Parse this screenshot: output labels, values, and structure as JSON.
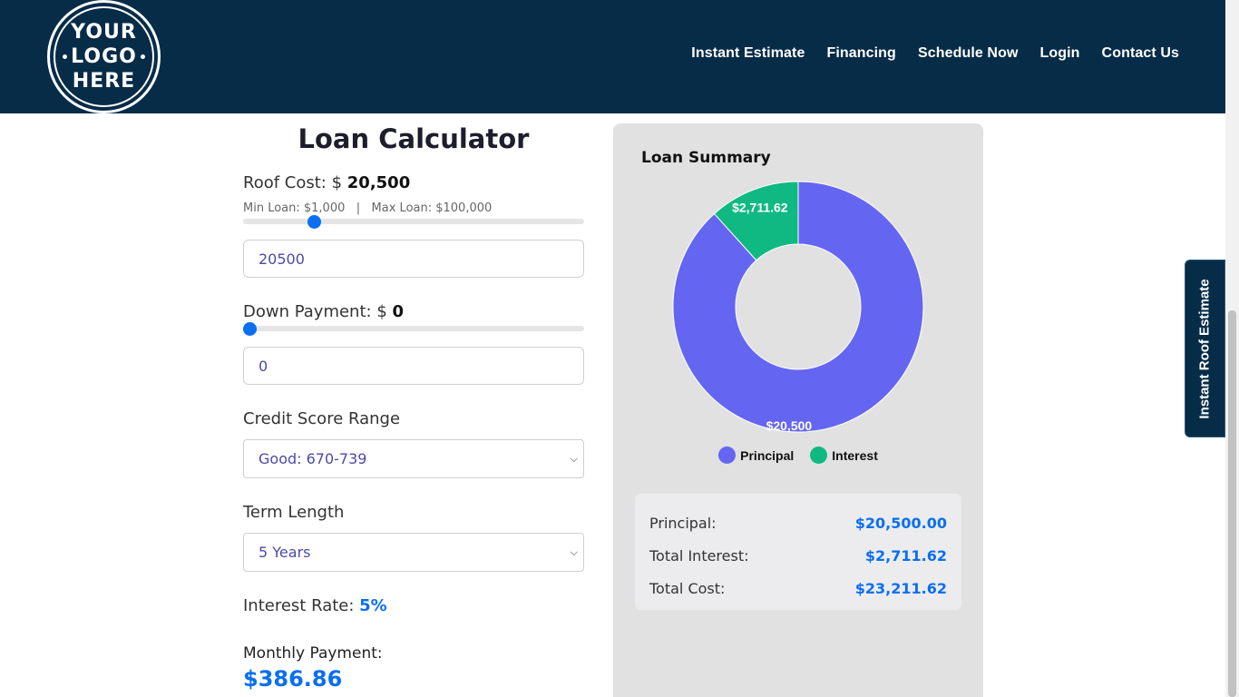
{
  "header": {
    "logo_lines": [
      "YOUR",
      "LOGO",
      "HERE"
    ],
    "nav": [
      "Instant Estimate",
      "Financing",
      "Schedule Now",
      "Login",
      "Contact Us"
    ]
  },
  "calculator": {
    "title": "Loan Calculator",
    "roof_cost": {
      "label": "Roof Cost: $ ",
      "value": "20,500",
      "input_value": "20500",
      "slider_level": 0.197
    },
    "min_max": "Min Loan: $1,000   |   Max Loan: $100,000",
    "down_payment": {
      "label": "Down Payment: $ ",
      "value": "0",
      "input_value": "0",
      "slider_level": 0
    },
    "credit_score": {
      "label": "Credit Score Range",
      "selected": "Good: 670-739"
    },
    "term_length": {
      "label": "Term Length",
      "selected": "5 Years"
    },
    "interest_rate": {
      "label": "Interest Rate: ",
      "value": "5%"
    },
    "monthly_payment": {
      "label": "Monthly Payment:",
      "value": "$386.86"
    }
  },
  "summary": {
    "title": "Loan Summary",
    "legend": {
      "principal": "Principal",
      "interest": "Interest"
    },
    "rows": [
      {
        "label": "Principal:",
        "value": "$20,500.00"
      },
      {
        "label": "Total Interest:",
        "value": "$2,711.62"
      },
      {
        "label": "Total Cost:",
        "value": "$23,211.62"
      }
    ]
  },
  "chart_data": {
    "type": "pie",
    "categories": [
      "Principal",
      "Interest"
    ],
    "values": [
      20500,
      2711.62
    ],
    "data_labels": [
      "$20,500",
      "$2,711.62"
    ],
    "colors": [
      "#6466f1",
      "#10b981"
    ],
    "legend": "bottom"
  },
  "side_tab": {
    "label": "Instant Roof Estimate"
  },
  "colors": {
    "header_bg": "#072c48",
    "accent": "#0a6ff0",
    "panel_bg": "#e1e1e1"
  }
}
